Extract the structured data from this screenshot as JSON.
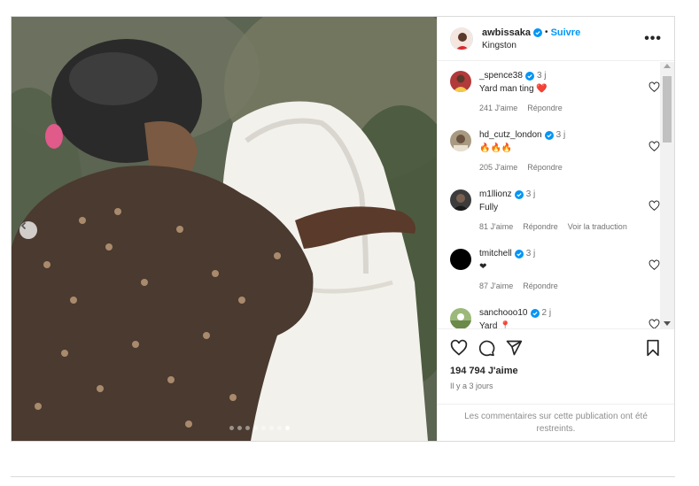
{
  "post": {
    "author": {
      "username": "awbissaka",
      "separator": "•",
      "follow_label": "Suivre",
      "location": "Kingston",
      "more_label": "•••"
    },
    "comments": [
      {
        "username": "_spence38",
        "time": "3 j",
        "text": "Yard man ting ❤️",
        "likes": "241 J'aime",
        "reply": "Répondre",
        "avatar_color": "#b23a3a"
      },
      {
        "username": "hd_cutz_london",
        "time": "3 j",
        "text": "🔥🔥🔥",
        "likes": "205 J'aime",
        "reply": "Répondre",
        "avatar_color": "#a89a80"
      },
      {
        "username": "m1llionz",
        "time": "3 j",
        "text": "Fully",
        "likes": "81 J'aime",
        "reply": "Répondre",
        "translate": "Voir la traduction",
        "avatar_color": "#3c3c3c"
      },
      {
        "username": "tmitchell",
        "time": "3 j",
        "text": "❤",
        "likes": "87 J'aime",
        "reply": "Répondre",
        "avatar_color": "#000000"
      },
      {
        "username": "sanchooo10",
        "time": "2 j",
        "text": "Yard 📍",
        "likes": "",
        "reply": "",
        "avatar_color": "#6b8a4a"
      }
    ],
    "likes_count": "194 794 J'aime",
    "date": "Il y a 3 jours",
    "restricted_notice": "Les commentaires sur cette publication ont été restreints."
  },
  "colors": {
    "accent": "#0095f6",
    "verified": "#0095f6",
    "secondary_text": "#737373",
    "border": "#dbdbdb"
  },
  "icons": {
    "like": "heart-icon",
    "comment": "comment-icon",
    "share": "paper-plane-icon",
    "save": "bookmark-icon",
    "prev": "chevron-left-icon"
  },
  "carousel": {
    "slide_count": 8,
    "active_index": 7
  }
}
